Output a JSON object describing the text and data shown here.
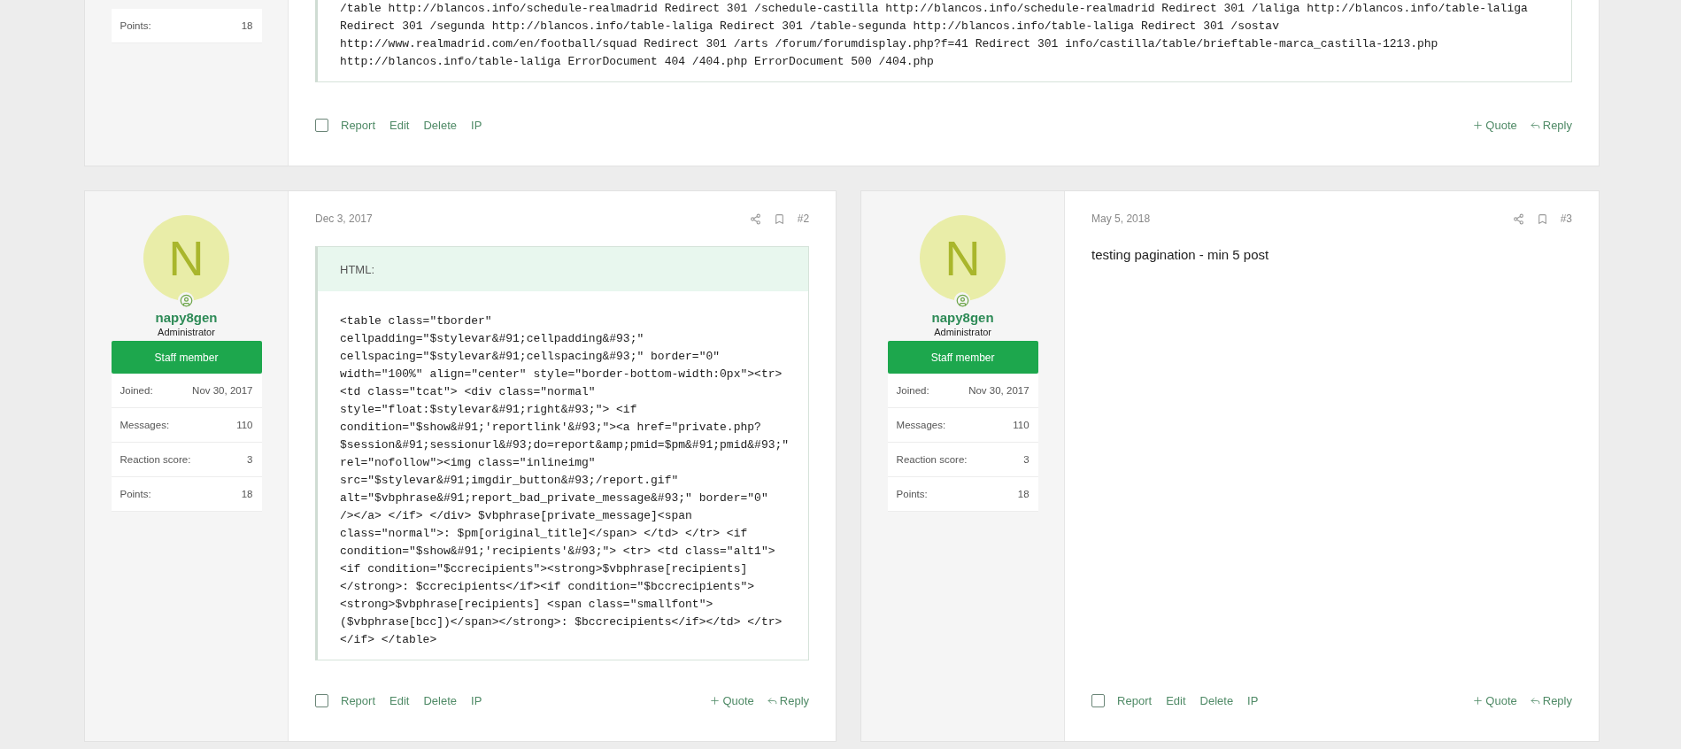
{
  "top_post": {
    "selected": false,
    "stats": [
      {
        "label": "Points:",
        "value": "18"
      }
    ],
    "code_lines": [
      "/table http://blancos.info/schedule-realmadrid Redirect 301 /schedule-castilla http://blancos.info/schedule-realmadrid Redirect 301 /laliga http://blancos.info/table-laliga",
      "Redirect 301 /segunda http://blancos.info/table-laliga Redirect 301 /table-segunda http://blancos.info/table-laliga Redirect 301 /sostav",
      "http://www.realmadrid.com/en/football/squad Redirect 301 /arts /forum/forumdisplay.php?f=41 Redirect 301 info/castilla/table/brieftable-marca_castilla-1213.php",
      "http://blancos.info/table-laliga ErrorDocument 404 /404.php ErrorDocument 500 /404.php"
    ],
    "actions": [
      "Report",
      "Edit",
      "Delete",
      "IP"
    ],
    "quote": "Quote",
    "reply": "Reply"
  },
  "posts": [
    {
      "selected": false,
      "avatar_letter": "N",
      "username": "napy8gen",
      "role": "Administrator",
      "badge": "Staff member",
      "stats": [
        {
          "label": "Joined:",
          "value": "Nov 30, 2017"
        },
        {
          "label": "Messages:",
          "value": "110"
        },
        {
          "label": "Reaction score:",
          "value": "3"
        },
        {
          "label": "Points:",
          "value": "18"
        }
      ],
      "date": "Dec 3, 2017",
      "number": "#2",
      "kind": "code",
      "code_title": "HTML:",
      "code_lines": [
        "<table class=\"tborder\"",
        "cellpadding=\"$stylevar&#91;cellpadding&#93;\"",
        "cellspacing=\"$stylevar&#91;cellspacing&#93;\" border=\"0\"",
        "width=\"100%\" align=\"center\" style=\"border-bottom-width:0px\"><tr>",
        "<td class=\"tcat\"> <div class=\"normal\"",
        "style=\"float:$stylevar&#91;right&#93;\"> <if",
        "condition=\"$show&#91;'reportlink'&#93;\"><a href=\"private.php?",
        "$session&#91;sessionurl&#93;do=report&amp;pmid=$pm&#91;pmid&#93;\"",
        "rel=\"nofollow\"><img class=\"inlineimg\"",
        "src=\"$stylevar&#91;imgdir_button&#93;/report.gif\"",
        "alt=\"$vbphrase&#91;report_bad_private_message&#93;\" border=\"0\"",
        "/></a> </if> </div> $vbphrase[private_message]<span",
        "class=\"normal\">: $pm[original_title]</span> </td> </tr> <if",
        "condition=\"$show&#91;'recipients'&#93;\"> <tr> <td class=\"alt1\">",
        "<if condition=\"$ccrecipients\"><strong>$vbphrase[recipients]",
        "</strong>: $ccrecipients</if><if condition=\"$bccrecipients\">",
        "<strong>$vbphrase[recipients] <span class=\"smallfont\">",
        "($vbphrase[bcc])</span></strong>: $bccrecipients</if></td> </tr>",
        "</if> </table>"
      ],
      "actions": [
        "Report",
        "Edit",
        "Delete",
        "IP"
      ],
      "quote": "Quote",
      "reply": "Reply"
    },
    {
      "selected": false,
      "avatar_letter": "N",
      "username": "napy8gen",
      "role": "Administrator",
      "badge": "Staff member",
      "stats": [
        {
          "label": "Joined:",
          "value": "Nov 30, 2017"
        },
        {
          "label": "Messages:",
          "value": "110"
        },
        {
          "label": "Reaction score:",
          "value": "3"
        },
        {
          "label": "Points:",
          "value": "18"
        }
      ],
      "date": "May 5, 2018",
      "number": "#3",
      "kind": "text",
      "text": "testing pagination - min 5 post",
      "actions": [
        "Report",
        "Edit",
        "Delete",
        "IP"
      ],
      "quote": "Quote",
      "reply": "Reply"
    }
  ]
}
